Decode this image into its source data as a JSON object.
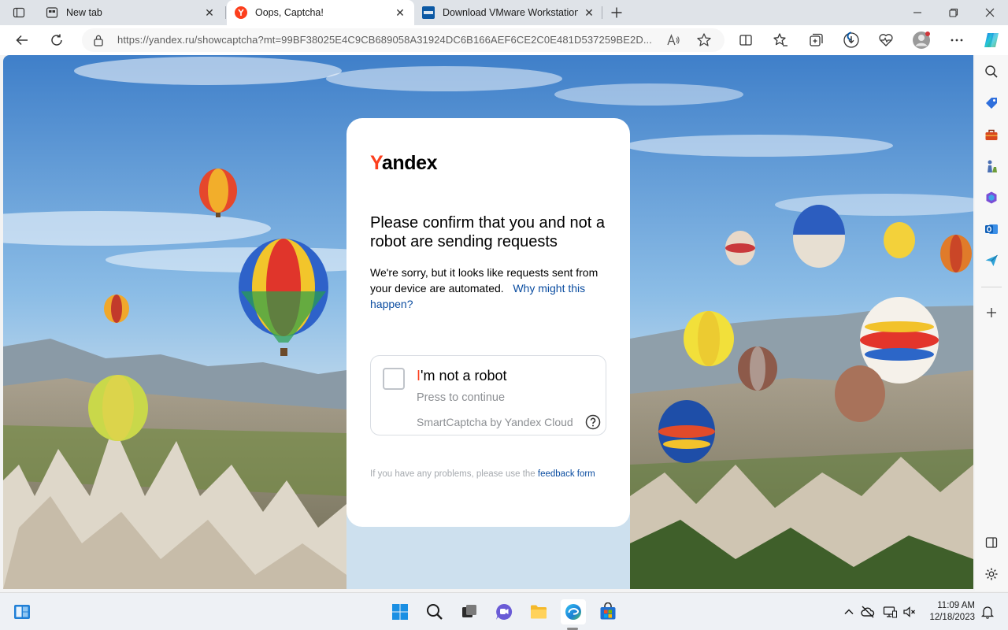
{
  "browser": {
    "tabs": [
      {
        "title": "New tab",
        "close": "✕"
      },
      {
        "title": "Oops, Captcha!",
        "close": "✕"
      },
      {
        "title": "Download VMware Workstation Pro",
        "close": "✕"
      }
    ],
    "active_tab_index": 1,
    "url": "https://yandex.ru/showcaptcha?mt=99BF38025E4C9CB689058A31924DC6B166AEF6CE2C0E481D537259BE2D..."
  },
  "page": {
    "logo": {
      "first_letter": "Y",
      "rest": "andex"
    },
    "heading": "Please confirm that you and not a robot are sending requests",
    "description": "We're sorry, but it looks like requests sent from your device are automated.",
    "why_link": "Why might this happen?",
    "captcha": {
      "label_first_letter": "I",
      "label_rest": "'m not a robot",
      "press_text": "Press to continue",
      "provider": "SmartCaptcha by Yandex Cloud"
    },
    "footer_text": "If you have any problems, please use the",
    "footer_link": "feedback form"
  },
  "taskbar": {
    "time": "11:09 AM",
    "date": "12/18/2023"
  },
  "colors": {
    "yandex_red": "#fc3f1d",
    "link_blue": "#0a4ca0",
    "edge_blue": "#0c59a4"
  }
}
